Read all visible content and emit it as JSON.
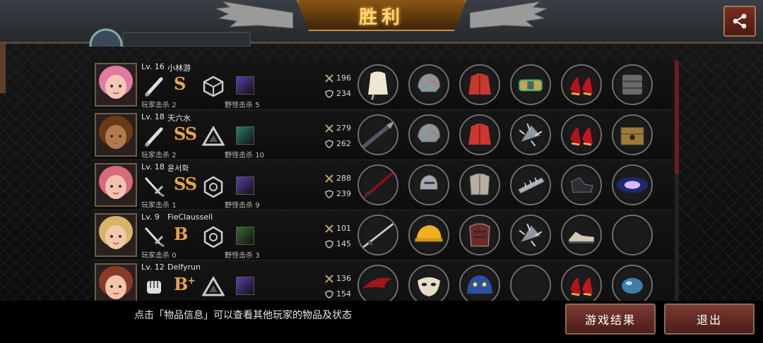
{
  "header": {
    "title": "胜利",
    "partial_name": "小林游"
  },
  "players": [
    {
      "level": "Lv. 16",
      "name": "小林游",
      "rank": "S",
      "rank_plus": "",
      "player_kills_label": "玩家击杀",
      "player_kills": "2",
      "monster_kills_label": "野怪击杀",
      "monster_kills": "5",
      "atk": "196",
      "def": "234",
      "weapon": "bat",
      "class": "cube",
      "skill_color": "#5b3ea8",
      "hair": "#e07aa0",
      "skin": "#f4c6b8",
      "items": [
        "white-cape",
        "steel-helm",
        "red-jacket",
        "gold-bracer",
        "red-heels",
        "iron-armor"
      ]
    },
    {
      "level": "Lv. 18",
      "name": "天六水",
      "rank": "SS",
      "rank_plus": "",
      "player_kills_label": "玩家击杀",
      "player_kills": "2",
      "monster_kills_label": "野怪击杀",
      "monster_kills": "10",
      "atk": "279",
      "def": "262",
      "weapon": "bat",
      "class": "triangle",
      "skill_color": "#2e7d6a",
      "hair": "#6a3a18",
      "skin": "#b47a4e",
      "items": [
        "spear",
        "steel-helm",
        "red-jacket",
        "spiked-gauntlet",
        "red-heels",
        "treasure-box"
      ]
    },
    {
      "level": "Lv. 18",
      "name": "윤서화",
      "rank": "SS",
      "rank_plus": "",
      "player_kills_label": "玩家击杀",
      "player_kills": "1",
      "monster_kills_label": "野怪击杀",
      "monster_kills": "9",
      "atk": "288",
      "def": "239",
      "weapon": "sword",
      "class": "hex",
      "skill_color": "#5b3ea8",
      "hair": "#d76b7a",
      "skin": "#f3c1b0",
      "items": [
        "crimson-blade",
        "knight-helm",
        "plate-armor",
        "steel-bracer",
        "black-boots",
        "galaxy-orb"
      ]
    },
    {
      "level": "Lv. 9",
      "name": "FieClaussell",
      "rank": "B",
      "rank_plus": "",
      "player_kills_label": "玩家击杀",
      "player_kills": "0",
      "monster_kills_label": "野怪击杀",
      "monster_kills": "3",
      "atk": "101",
      "def": "145",
      "weapon": "sword",
      "class": "hex",
      "skill_color": "#3a6a2a",
      "hair": "#d8b46a",
      "skin": "#f2c9a6",
      "items": [
        "long-sword",
        "hard-hat",
        "red-armor",
        "spiked-gauntlet",
        "sneakers",
        ""
      ]
    },
    {
      "level": "Lv. 12",
      "name": "Delfyrun",
      "rank": "B",
      "rank_plus": "+",
      "player_kills_label": "",
      "player_kills": "",
      "monster_kills_label": "",
      "monster_kills": "",
      "atk": "136",
      "def": "154",
      "weapon": "fist",
      "class": "triangle",
      "skill_color": "#5b3ea8",
      "hair": "#8a3a2a",
      "skin": "#f0c4a8",
      "items": [
        "red-wing",
        "white-mask",
        "blue-creature",
        "",
        "red-heels",
        "blue-orb"
      ]
    }
  ],
  "footer": {
    "hint": "点击「物品信息」可以查看其他玩家的物品及状态",
    "results_button": "游戏结果",
    "exit_button": "退出"
  },
  "colors": {
    "accent": "#e7a44a",
    "button": "#6b2c25",
    "banner": "#ffd779"
  },
  "icons": {
    "share": "share-icon",
    "attack": "crossed-swords-icon",
    "defense": "shield-icon"
  }
}
